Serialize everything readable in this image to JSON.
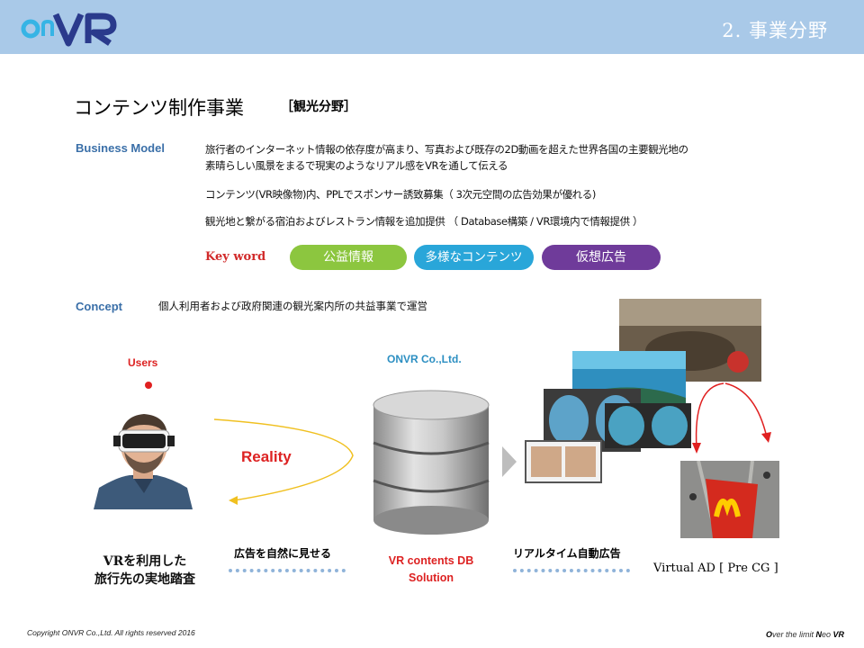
{
  "header": {
    "section": "2. 事業分野",
    "logo_text": "OnVR",
    "color": "#a9c9e8"
  },
  "title": {
    "main": "コンテンツ制作事業",
    "sub": "［観光分野］"
  },
  "business_model": {
    "label": "Business Model",
    "lines": [
      "旅行者のインターネット情報の依存度が高まり、写真および既存の2D動画を超えた世界各国の主要観光地の",
      "素晴らしい風景をまるで現実のようなリアル感をVRを通して伝える",
      "コンテンツ(VR映像物)内、PPLでスポンサー誘致募集（ 3次元空間の広告効果が優れる)",
      "観光地と繋がる宿泊およびレストラン情報を追加提供 （ Database構築 / VR環境内で情報提供 ）"
    ]
  },
  "keywords": {
    "label": "Key word",
    "items": [
      "公益情報",
      "多様なコンテンツ",
      "仮想広告"
    ],
    "colors": [
      "#8cc63f",
      "#29a6d9",
      "#6f3b9a"
    ]
  },
  "concept": {
    "label": "Concept",
    "text": "個人利用者および政府関連の観光案内所の共益事業で運営"
  },
  "diagram": {
    "users_label": "Users",
    "company_label": "ONVR Co.,Ltd.",
    "reality_label": "Reality",
    "caption_ad_natural": "広告を自然に見せる",
    "caption_realtime": "リアルタイム自動広告",
    "caption_user_line1": "VRを利用した",
    "caption_user_line2": "旅行先の実地踏査",
    "caption_db_line1": "VR contents DB",
    "caption_db_line2": "Solution",
    "caption_ad": "Virtual AD [ Pre CG ]",
    "user_photo_icon": "vr-headset-user-photo",
    "database_icon": "database-cylinder-icon",
    "mcdonalds_icon": "mcdonalds-ad-photo"
  },
  "footer": {
    "copyright": "Copyright  ONVR Co.,Ltd. All rights reserved 2016",
    "tagline_part1": "O",
    "tagline_part2": "ver the limit ",
    "tagline_part3": "N",
    "tagline_part4": "eo ",
    "tagline_part5": "VR"
  }
}
